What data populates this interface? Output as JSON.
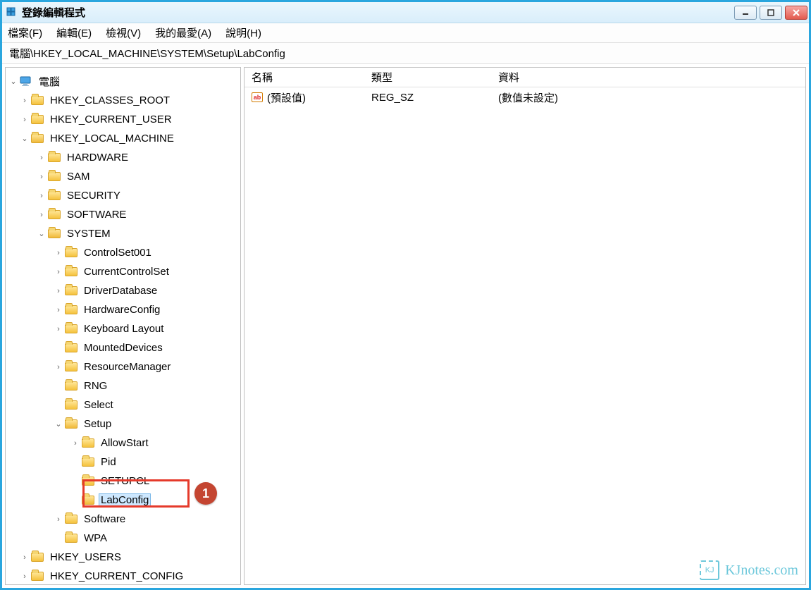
{
  "window": {
    "title": "登錄編輯程式"
  },
  "menu": {
    "file": "檔案(F)",
    "edit": "編輯(E)",
    "view": "檢視(V)",
    "favorites": "我的最愛(A)",
    "help": "說明(H)"
  },
  "path": "電腦\\HKEY_LOCAL_MACHINE\\SYSTEM\\Setup\\LabConfig",
  "columns": {
    "name": "名稱",
    "type": "類型",
    "data": "資料"
  },
  "rows": [
    {
      "name": "(預設值)",
      "type": "REG_SZ",
      "data": "(數值未設定)"
    }
  ],
  "tree": {
    "root": "電腦",
    "hives": {
      "hkcr": "HKEY_CLASSES_ROOT",
      "hkcu": "HKEY_CURRENT_USER",
      "hklm": "HKEY_LOCAL_MACHINE",
      "hku": "HKEY_USERS",
      "hkcc": "HKEY_CURRENT_CONFIG"
    },
    "hklm": {
      "hardware": "HARDWARE",
      "sam": "SAM",
      "security": "SECURITY",
      "software": "SOFTWARE",
      "system": "SYSTEM"
    },
    "system": {
      "cs001": "ControlSet001",
      "ccs": "CurrentControlSet",
      "drvdb": "DriverDatabase",
      "hwcfg": "HardwareConfig",
      "kbl": "Keyboard Layout",
      "md": "MountedDevices",
      "rm": "ResourceManager",
      "rng": "RNG",
      "select": "Select",
      "setup": "Setup",
      "soft": "Software",
      "wpa": "WPA"
    },
    "setup": {
      "allowstart": "AllowStart",
      "pid": "Pid",
      "setupcl": "SETUPCL",
      "labconfig": "LabConfig"
    }
  },
  "annotation": {
    "badge": "1"
  },
  "watermark": "KJnotes.com"
}
